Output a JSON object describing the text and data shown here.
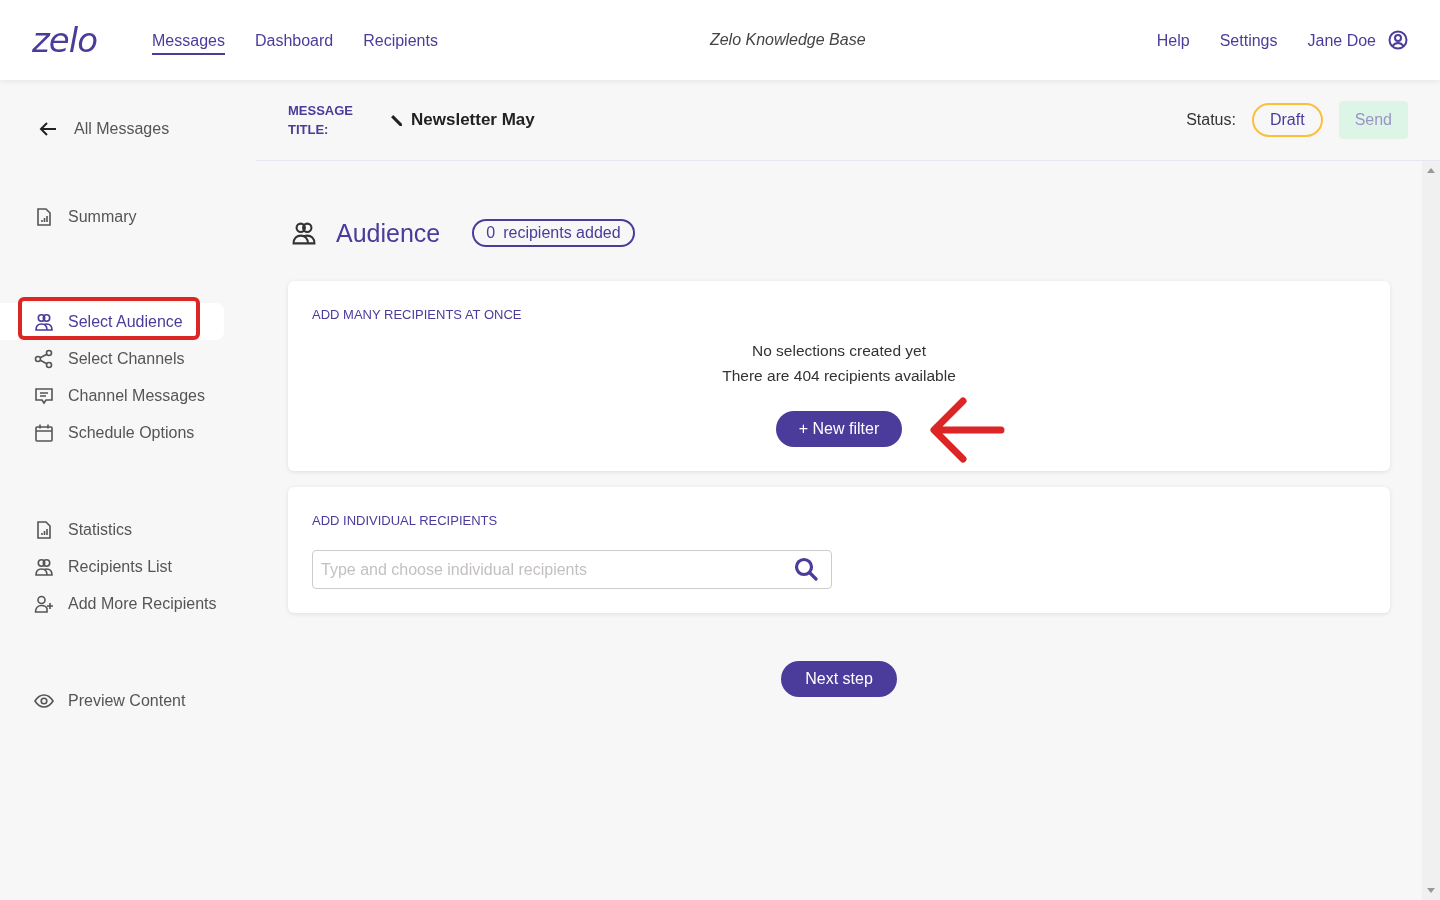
{
  "header": {
    "logo": "zelo",
    "nav": [
      {
        "label": "Messages",
        "selected": true
      },
      {
        "label": "Dashboard",
        "selected": false
      },
      {
        "label": "Recipients",
        "selected": false
      }
    ],
    "center_link": "Zelo Knowledge Base",
    "right_links": [
      "Help",
      "Settings"
    ],
    "user": "Jane Doe"
  },
  "sidebar": {
    "back": "All Messages",
    "groups": [
      [
        {
          "label": "Summary",
          "kind": "report",
          "selected": false
        }
      ],
      [
        {
          "label": "Select Audience",
          "kind": "people",
          "selected": true
        },
        {
          "label": "Select Channels",
          "kind": "share",
          "selected": false
        },
        {
          "label": "Channel Messages",
          "kind": "chat",
          "selected": false
        },
        {
          "label": "Schedule Options",
          "kind": "calendar",
          "selected": false
        }
      ],
      [
        {
          "label": "Statistics",
          "kind": "report",
          "selected": false
        },
        {
          "label": "Recipients List",
          "kind": "people",
          "selected": false
        },
        {
          "label": "Add More Recipients",
          "kind": "adduser",
          "selected": false
        }
      ],
      [
        {
          "label": "Preview Content",
          "kind": "eye",
          "selected": false
        }
      ]
    ]
  },
  "title_bar": {
    "label": "MESSAGE TITLE:",
    "title": "Newsletter May",
    "status_label": "Status:",
    "status": "Draft",
    "send": {
      "label": "Send",
      "disabled": true
    }
  },
  "audience": {
    "heading": "Audience",
    "count": "0",
    "count_label": "recipients added"
  },
  "bulk_card": {
    "heading": "ADD MANY RECIPIENTS AT ONCE",
    "lines": [
      "No selections created yet",
      "There are 404 recipients available"
    ],
    "button": "+ New filter"
  },
  "individual_card": {
    "heading": "ADD INDIVIDUAL RECIPIENTS",
    "search": {
      "placeholder": "Type and choose individual recipients"
    }
  },
  "next_button": "Next step"
}
